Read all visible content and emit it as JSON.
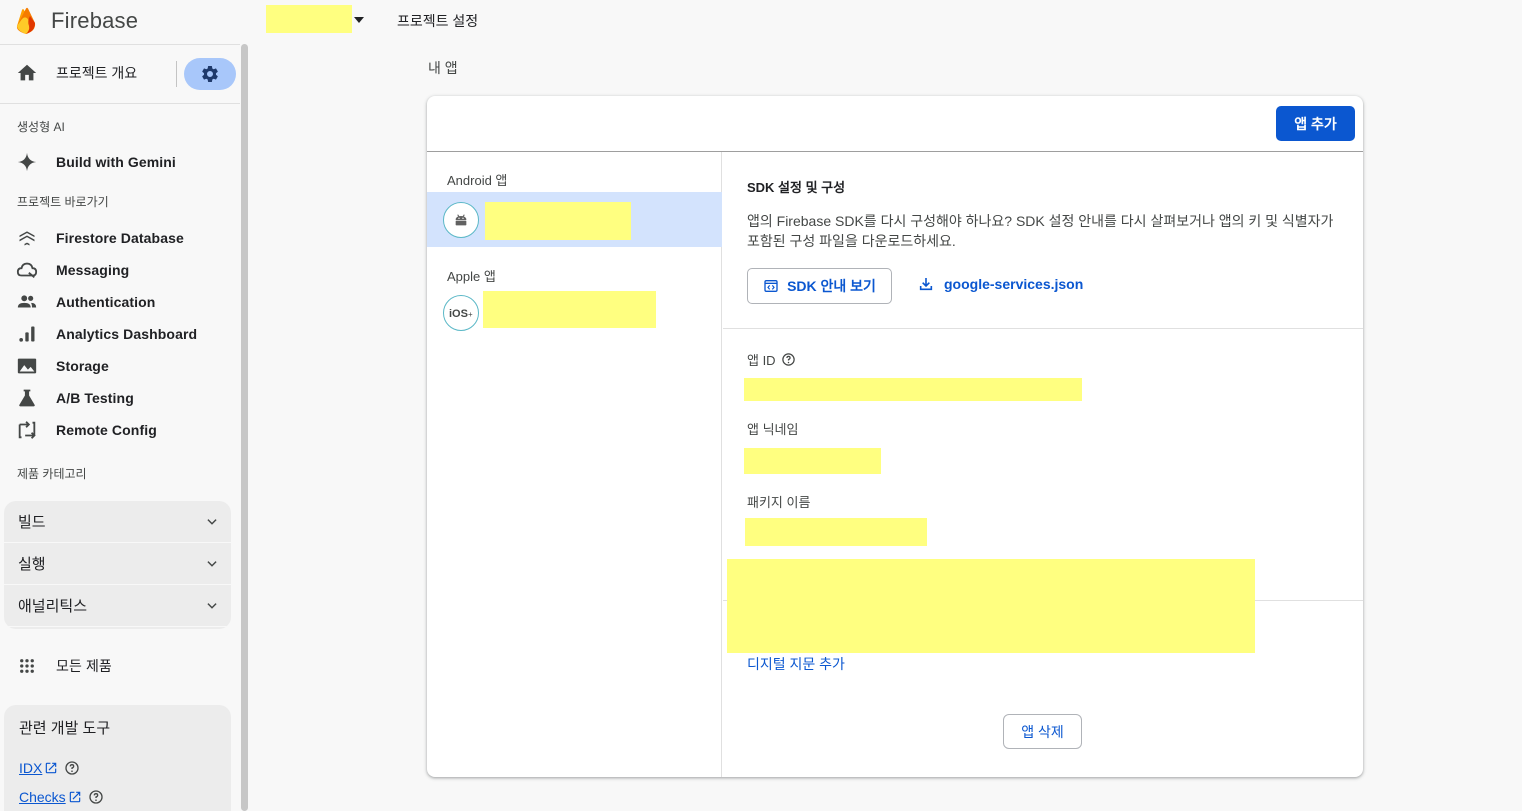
{
  "brand": {
    "name": "Firebase"
  },
  "topbar": {
    "page_title": "프로젝트 설정"
  },
  "sidebar": {
    "overview_label": "프로젝트 개요",
    "genai_section": "생성형 AI",
    "gemini_label": "Build with Gemini",
    "shortcuts_section": "프로젝트 바로가기",
    "shortcuts": [
      {
        "label": "Firestore Database",
        "icon": "firestore-icon"
      },
      {
        "label": "Messaging",
        "icon": "messaging-icon"
      },
      {
        "label": "Authentication",
        "icon": "people-icon"
      },
      {
        "label": "Analytics Dashboard",
        "icon": "bar-chart-icon"
      },
      {
        "label": "Storage",
        "icon": "image-icon"
      },
      {
        "label": "A/B Testing",
        "icon": "flask-icon"
      },
      {
        "label": "Remote Config",
        "icon": "remote-config-icon"
      }
    ],
    "categories_section": "제품 카테고리",
    "categories": [
      {
        "label": "빌드"
      },
      {
        "label": "실행"
      },
      {
        "label": "애널리틱스"
      }
    ],
    "all_products_label": "모든 제품",
    "devtools_title": "관련 개발 도구",
    "devtools": [
      {
        "label": "IDX"
      },
      {
        "label": "Checks"
      }
    ]
  },
  "main": {
    "section_title": "내 앱",
    "add_app_label": "앱 추가",
    "android_label": "Android 앱",
    "apple_label": "Apple 앱",
    "sdk_title": "SDK 설정 및 구성",
    "sdk_desc": "앱의 Firebase SDK를 다시 구성해야 하나요? SDK 설정 안내를 다시 살펴보거나 앱의 키 및 식별자가 포함된 구성 파일을 다운로드하세요.",
    "sdk_button_label": "SDK 안내 보기",
    "download_label": "google-services.json",
    "app_id_label": "앱 ID",
    "nickname_label": "앱 닉네임",
    "package_label": "패키지 이름",
    "fingerprint_link": "디지털 지문 추가",
    "delete_label": "앱 삭제"
  },
  "colors": {
    "accent": "#0b57d0",
    "selected_bg": "#d3e3fd",
    "gear_bg": "#a8c7fa",
    "redaction": "#ffff80"
  }
}
